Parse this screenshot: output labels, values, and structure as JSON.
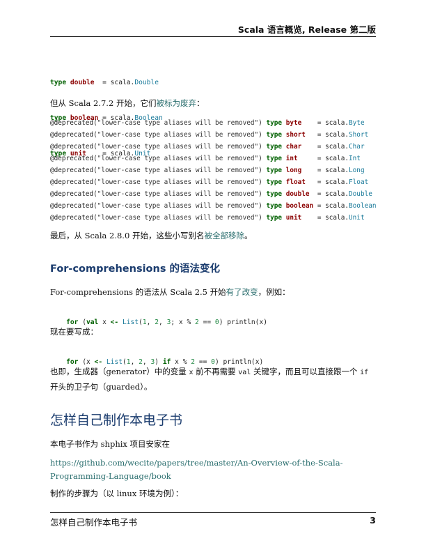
{
  "header": {
    "title": "Scala 语言概览, Release 第二版"
  },
  "alias_block": [
    {
      "kw": "type",
      "name": "double ",
      "eq": " = scala.",
      "cls": "Double"
    },
    {
      "kw": "type",
      "name": "boolean",
      "eq": " = scala.",
      "cls": "Boolean"
    },
    {
      "kw": "type",
      "name": "unit   ",
      "eq": " = scala.",
      "cls": "Unit"
    }
  ],
  "para1": {
    "a": "但从 ",
    "b": "Scala 2.7.2",
    "c": " 开始，它们",
    "link": "被标为废弃",
    "d": "："
  },
  "deprecated_block": [
    {
      "ann": "@deprecated(",
      "msg": "\"lower-case type aliases will be removed\"",
      "close": ") ",
      "kw": "type",
      "name": "byte   ",
      "eq": " = scala.",
      "cls": "Byte"
    },
    {
      "ann": "@deprecated(",
      "msg": "\"lower-case type aliases will be removed\"",
      "close": ") ",
      "kw": "type",
      "name": "short  ",
      "eq": " = scala.",
      "cls": "Short"
    },
    {
      "ann": "@deprecated(",
      "msg": "\"lower-case type aliases will be removed\"",
      "close": ") ",
      "kw": "type",
      "name": "char   ",
      "eq": " = scala.",
      "cls": "Char"
    },
    {
      "ann": "@deprecated(",
      "msg": "\"lower-case type aliases will be removed\"",
      "close": ") ",
      "kw": "type",
      "name": "int    ",
      "eq": " = scala.",
      "cls": "Int"
    },
    {
      "ann": "@deprecated(",
      "msg": "\"lower-case type aliases will be removed\"",
      "close": ") ",
      "kw": "type",
      "name": "long   ",
      "eq": " = scala.",
      "cls": "Long"
    },
    {
      "ann": "@deprecated(",
      "msg": "\"lower-case type aliases will be removed\"",
      "close": ") ",
      "kw": "type",
      "name": "float  ",
      "eq": " = scala.",
      "cls": "Float"
    },
    {
      "ann": "@deprecated(",
      "msg": "\"lower-case type aliases will be removed\"",
      "close": ") ",
      "kw": "type",
      "name": "double ",
      "eq": " = scala.",
      "cls": "Double"
    },
    {
      "ann": "@deprecated(",
      "msg": "\"lower-case type aliases will be removed\"",
      "close": ") ",
      "kw": "type",
      "name": "boolean",
      "eq": " = scala.",
      "cls": "Boolean"
    },
    {
      "ann": "@deprecated(",
      "msg": "\"lower-case type aliases will be removed\"",
      "close": ") ",
      "kw": "type",
      "name": "unit   ",
      "eq": " = scala.",
      "cls": "Unit"
    }
  ],
  "para2": {
    "a": "最后，从 ",
    "b": "Scala 2.8.0",
    "c": " 开始，这些小写别名",
    "link": "被全部移除",
    "d": "。"
  },
  "section_heading": "For-comprehensions 的语法变化",
  "para3": {
    "a": "For-comprehensions",
    "b": " 的语法从 ",
    "c": "Scala 2.5",
    "d": " 开始",
    "link": "有了改变",
    "e": "，例如："
  },
  "code_old": {
    "for": "for",
    "p1": " (",
    "val": "val",
    "p2": " x ",
    "arrow": "<-",
    "p3": " ",
    "list": "List",
    "p4": "(",
    "n1": "1",
    "p5": ", ",
    "n2": "2",
    "p6": ", ",
    "n3": "3",
    "p7": "; x % ",
    "n4": "2",
    "p8": " == ",
    "n5": "0",
    "p9": ") println(x)"
  },
  "para4": "现在要写成：",
  "code_new": {
    "for": "for",
    "p1": " (x ",
    "arrow": "<-",
    "p2": " ",
    "list": "List",
    "p3": "(",
    "n1": "1",
    "p4": ", ",
    "n2": "2",
    "p5": ", ",
    "n3": "3",
    "p6": ") ",
    "if": "if",
    "p7": " x % ",
    "n4": "2",
    "p8": " == ",
    "n5": "0",
    "p9": ") println(x)"
  },
  "para5": {
    "a": "也即，生成器（",
    "b": "generator",
    "c": "）中的变量 ",
    "d": "x",
    "e": " 前不再需要 ",
    "f": "val",
    "g": " 关键字，而且可以直接跟一个 ",
    "h": "if",
    "line2a": "开头的卫子句（",
    "line2b": "guarded",
    "line2c": "）。"
  },
  "chapter_heading": "怎样自己制作本电子书",
  "para6": {
    "a": "本电子书作为 ",
    "b": "shphix",
    "c": " 项目安家在"
  },
  "url": "https://github.com/wecite/papers/tree/master/An-Overview-of-the-Scala-Programming-Language/book",
  "para7": {
    "a": "制作的步骤为（以 ",
    "b": "linux",
    "c": " 环境为例）："
  },
  "footer": {
    "left": "怎样自己制作本电子书",
    "page": "3"
  }
}
